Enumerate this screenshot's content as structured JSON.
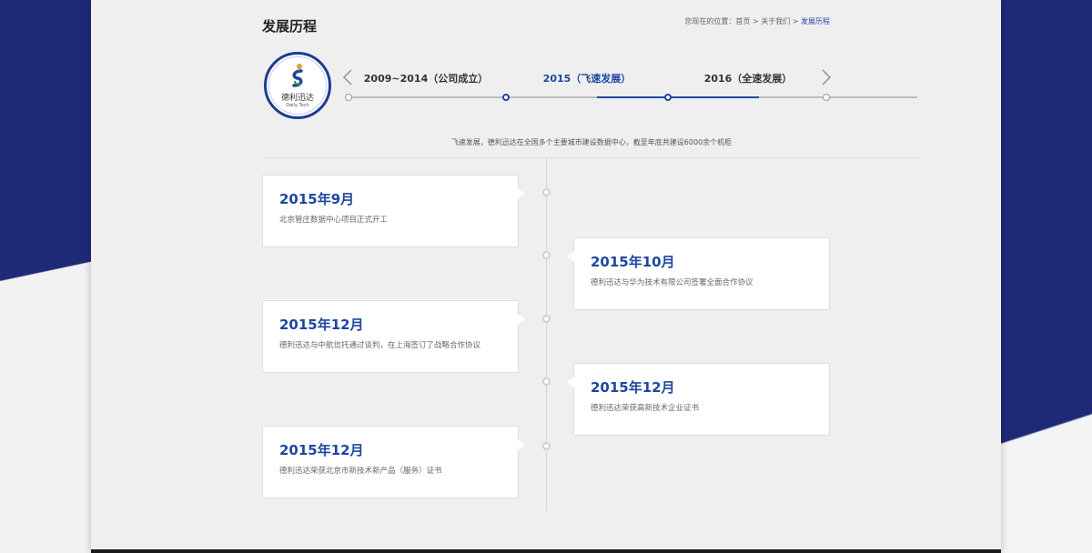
{
  "page": {
    "title": "发展历程",
    "breadcrumb": {
      "prefix": "您现在的位置：",
      "home": "首页",
      "sep1": " > ",
      "about": "关于我们",
      "sep2": " > ",
      "current": "发展历程"
    }
  },
  "logo": {
    "name": "德利迅达",
    "en": "Daily Tech"
  },
  "timeline_tabs": [
    {
      "label": "2009~2014（公司成立）",
      "active": false
    },
    {
      "label": "2015（飞速发展）",
      "active": true
    },
    {
      "label": "2016（全速发展）",
      "active": false
    }
  ],
  "subtitle": "飞速发展，德利迅达在全国多个主要城市建设数据中心，截至年底共建设6000余个机柜",
  "events": [
    {
      "date": "2015年9月",
      "text": "北京管庄数据中心项目正式开工",
      "side": "left"
    },
    {
      "date": "2015年10月",
      "text": "德利迅达与华为技术有限公司签署全面合作协议",
      "side": "right"
    },
    {
      "date": "2015年12月",
      "text": "德利迅达与中航信托通过谈判，在上海签订了战略合作协议",
      "side": "left"
    },
    {
      "date": "2015年12月",
      "text": "德利迅达荣获高新技术企业证书",
      "side": "right"
    },
    {
      "date": "2015年12月",
      "text": "德利迅达荣获北京市新技术新产品（服务）证书",
      "side": "left"
    }
  ],
  "colors": {
    "brand": "#1f47a0",
    "background": "#1e2a78",
    "panel": "#efeff0"
  },
  "icons": {
    "prev": "chevron-left-icon",
    "next": "chevron-right-icon"
  }
}
